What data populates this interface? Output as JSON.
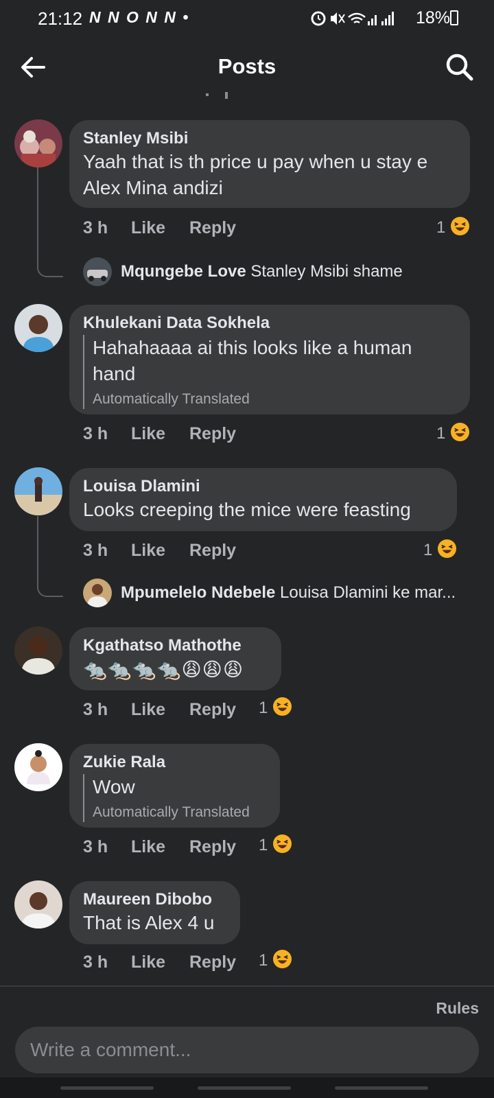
{
  "status_bar": {
    "time": "21:12",
    "notif_letters": "N N O N N •",
    "battery": "18%"
  },
  "header": {
    "title": "Posts",
    "back_icon": "arrow-left-icon",
    "search_icon": "search-icon"
  },
  "comments": [
    {
      "name": "Stanley Msibi",
      "text": "Yaah that is th price u pay when u stay e Alex Mina andizi",
      "time": "3 h",
      "like": "Like",
      "reply": "Reply",
      "reactions": "1",
      "reply_preview": {
        "name": "Mqungebe Love",
        "text": "Stanley Msibi shame"
      }
    },
    {
      "name": "Khulekani Data Sokhela",
      "text": "Hahahaaaa ai this looks like a human hand",
      "translated": "Automatically Translated",
      "time": "3 h",
      "like": "Like",
      "reply": "Reply",
      "reactions": "1"
    },
    {
      "name": "Louisa Dlamini",
      "text": "Looks creeping  the mice were feasting",
      "time": "3 h",
      "like": "Like",
      "reply": "Reply",
      "reactions": "1",
      "reply_preview": {
        "name": "Mpumelelo Ndebele",
        "text": "Louisa Dlamini ke mar..."
      }
    },
    {
      "name": "Kgathatso Mathothe",
      "text": "🐀🐀🐀🐀😩😩😩",
      "time": "3 h",
      "like": "Like",
      "reply": "Reply",
      "reactions": "1"
    },
    {
      "name": "Zukie Rala",
      "text": "Wow",
      "translated": "Automatically Translated",
      "time": "3 h",
      "like": "Like",
      "reply": "Reply",
      "reactions": "1"
    },
    {
      "name": "Maureen Dibobo",
      "text": "That is Alex 4 u",
      "time": "3 h",
      "like": "Like",
      "reply": "Reply",
      "reactions": "1"
    }
  ],
  "footer": {
    "rules": "Rules",
    "input_placeholder": "Write a comment..."
  },
  "colors": {
    "background": "#242526",
    "bubble": "#3a3b3c",
    "text": "#e4e6eb",
    "muted": "#b0b3b8",
    "reaction": "#f7b125"
  }
}
